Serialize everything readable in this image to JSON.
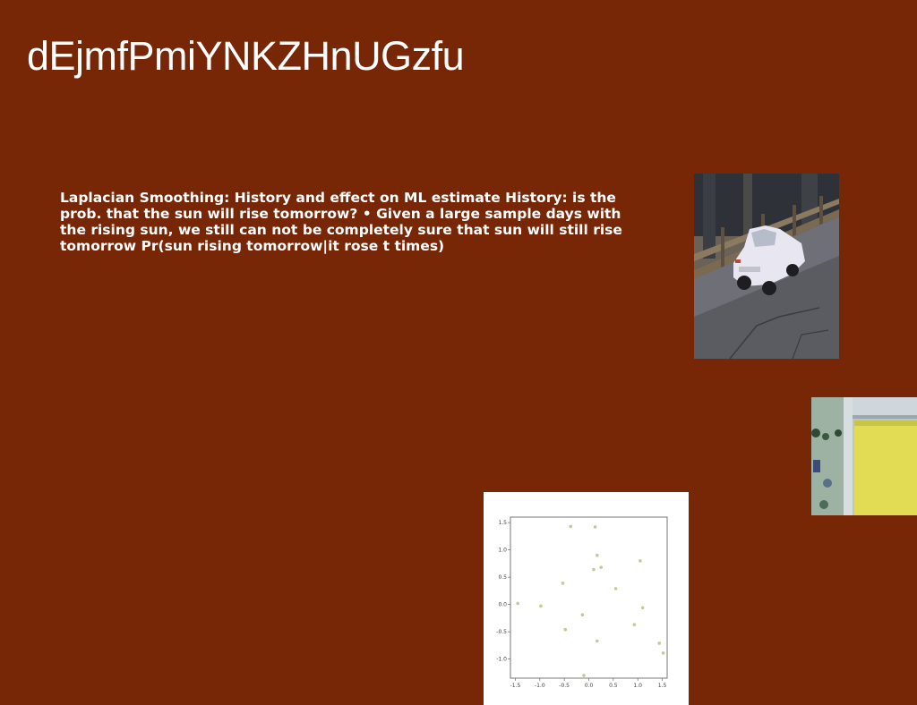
{
  "slide": {
    "background": "#772606",
    "title": "dEjmfPmiYNKZHnUGzfu",
    "body": "Laplacian Smoothing: History and effect on ML estimate History: is the prob. that the sun will rise tomorrow? • Given a large sample days with the rising sun, we still can not be completely sure that sun will still rise tomorrow Pr(sun rising tomorrow|it rose t times)"
  },
  "images": [
    {
      "icon": "car-photo-icon"
    },
    {
      "icon": "street-photo-icon"
    }
  ],
  "chart_data": {
    "type": "scatter",
    "title": "",
    "xlabel": "",
    "ylabel": "",
    "xlim": [
      -1.6,
      1.6
    ],
    "ylim": [
      -1.35,
      1.6
    ],
    "xticks": [
      "-1.5",
      "-1.0",
      "-0.5",
      "0.0",
      "0.5",
      "1.0",
      "1.5"
    ],
    "yticks": [
      "1.5",
      "1.0",
      "0.5",
      "0.0",
      "-0.5",
      "-1.0"
    ],
    "point_color": "#c8c890",
    "grid": false,
    "points": [
      {
        "x": -1.45,
        "y": 0.02
      },
      {
        "x": -0.98,
        "y": -0.03
      },
      {
        "x": -0.53,
        "y": 0.39
      },
      {
        "x": -0.48,
        "y": -0.46
      },
      {
        "x": -0.37,
        "y": 1.43
      },
      {
        "x": -0.13,
        "y": -0.19
      },
      {
        "x": -0.1,
        "y": -1.3
      },
      {
        "x": 0.1,
        "y": 0.64
      },
      {
        "x": 0.13,
        "y": 1.42
      },
      {
        "x": 0.17,
        "y": 0.9
      },
      {
        "x": 0.17,
        "y": -0.67
      },
      {
        "x": 0.25,
        "y": 0.68
      },
      {
        "x": 0.55,
        "y": 0.29
      },
      {
        "x": 0.93,
        "y": -0.37
      },
      {
        "x": 1.05,
        "y": 0.8
      },
      {
        "x": 1.1,
        "y": -0.06
      },
      {
        "x": 1.44,
        "y": -0.71
      },
      {
        "x": 1.52,
        "y": -0.89
      }
    ]
  }
}
